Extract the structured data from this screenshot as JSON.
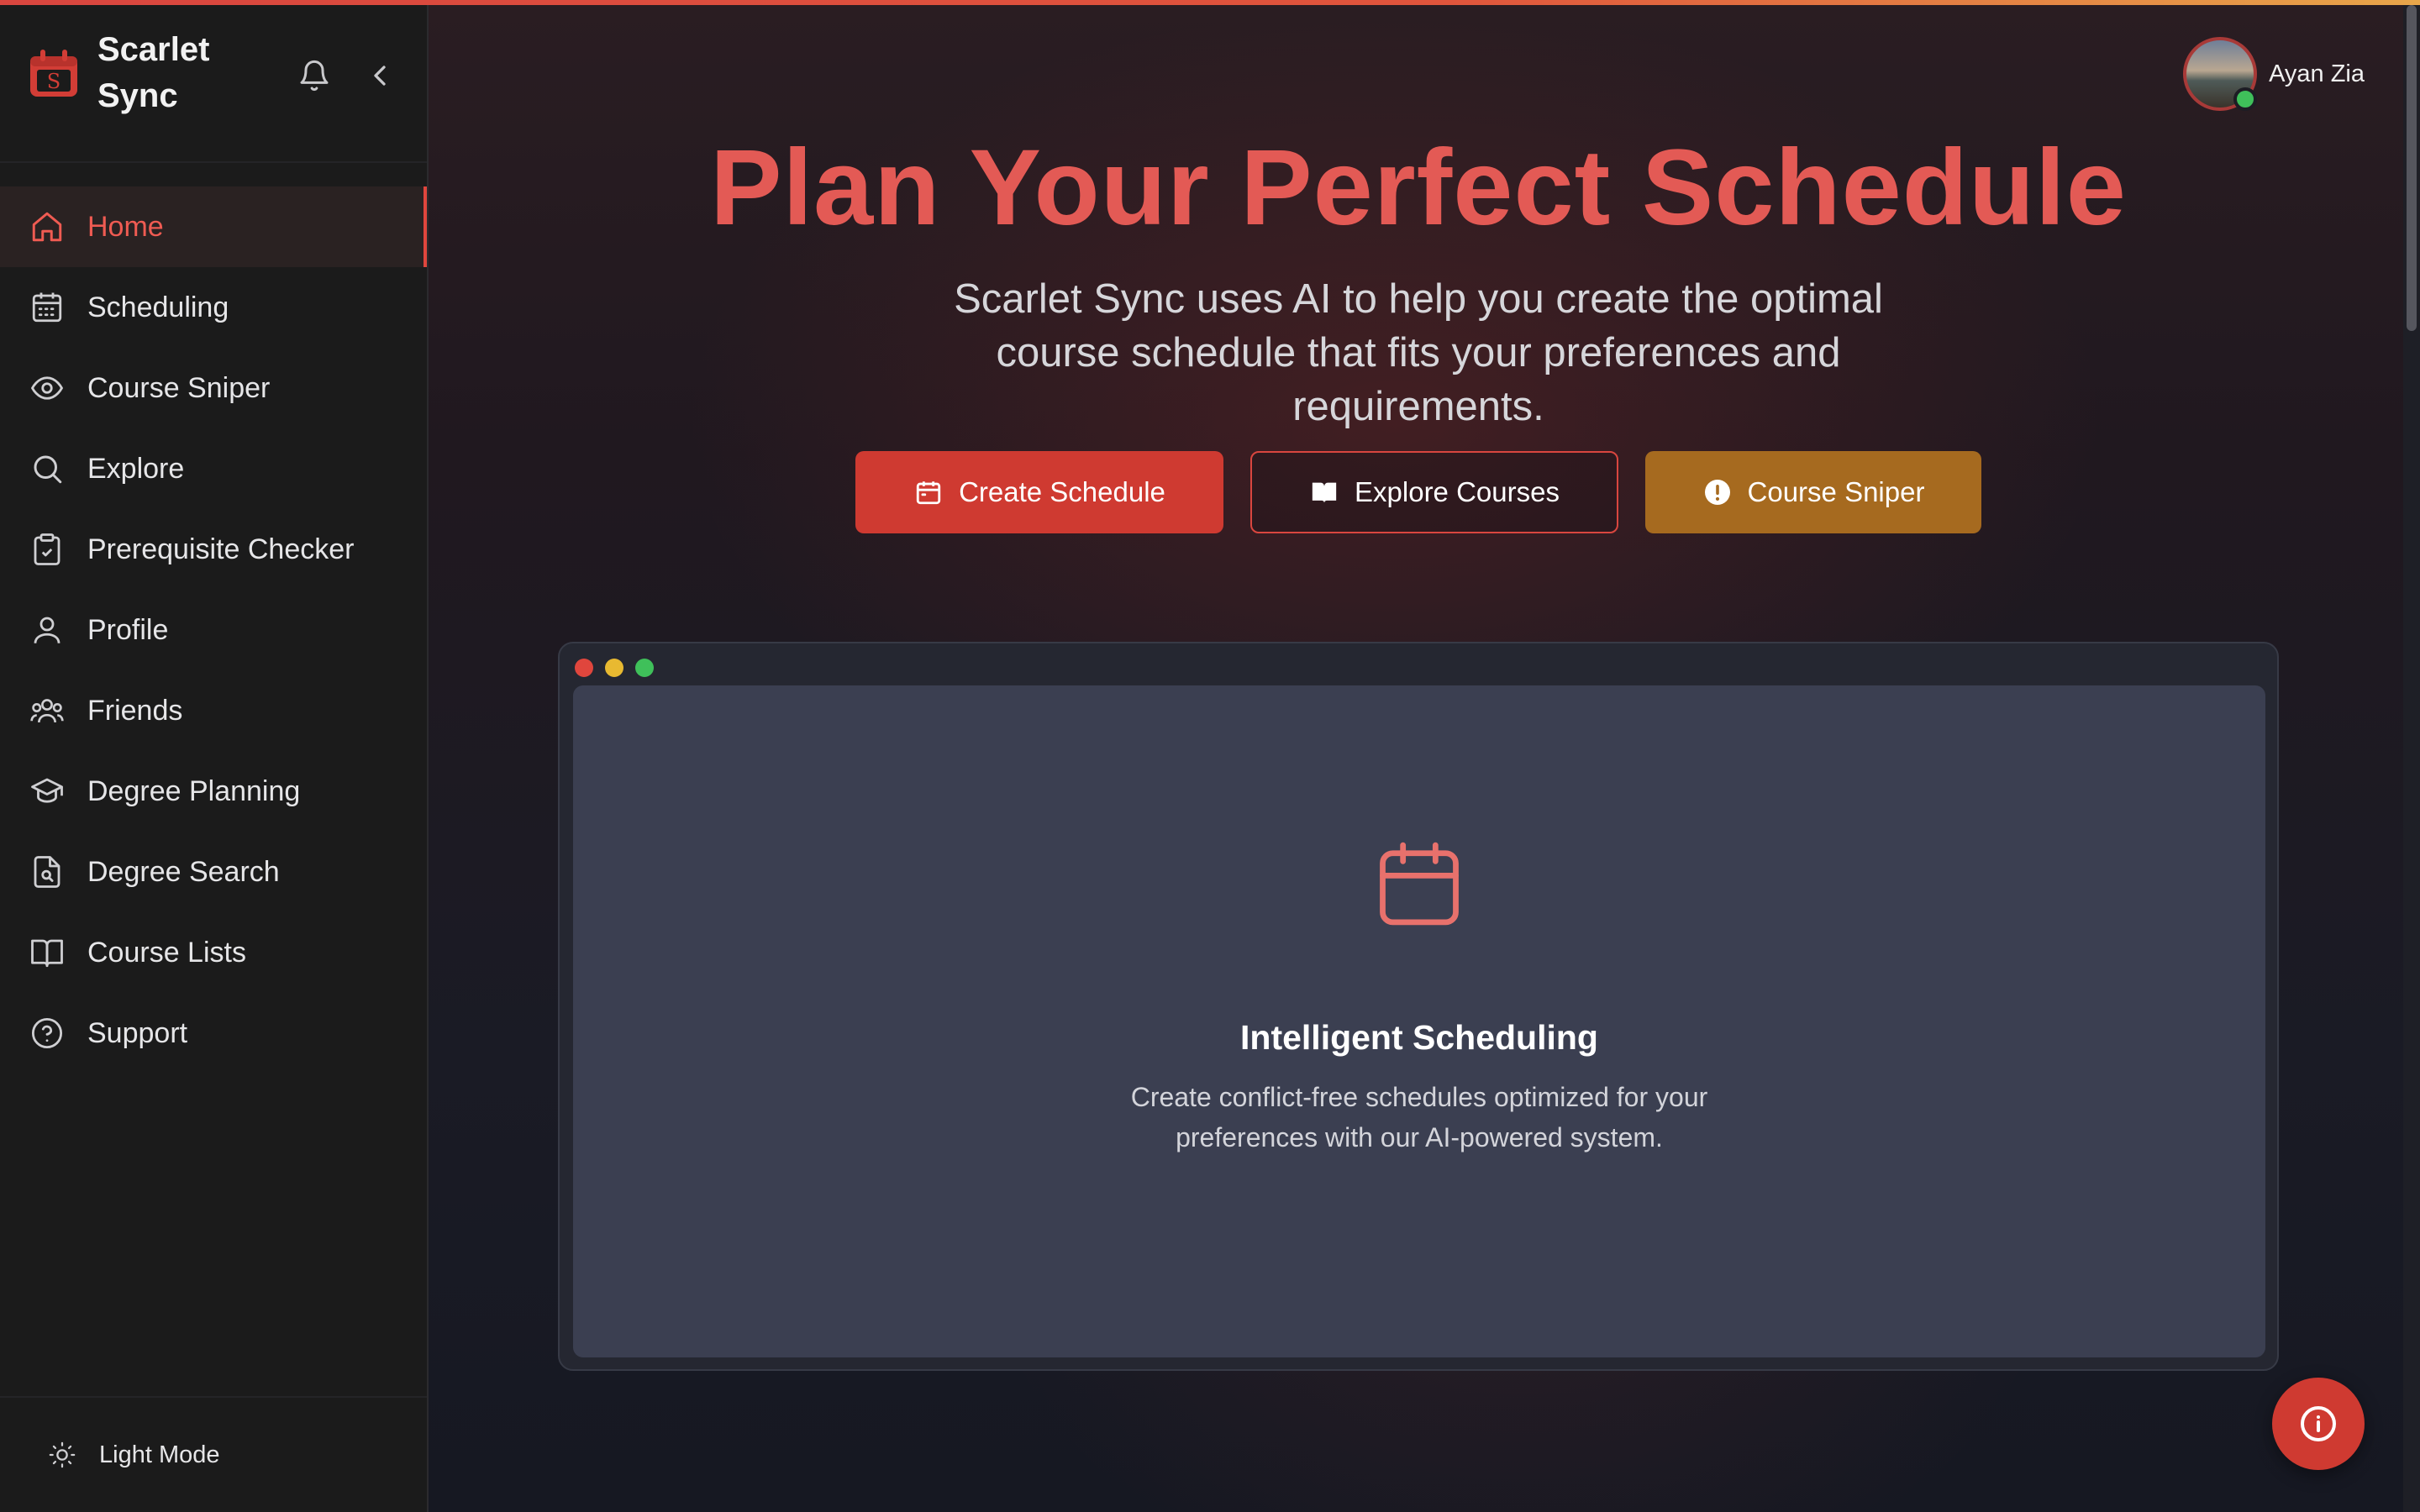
{
  "brand": {
    "name": "Scarlet Sync",
    "logo_icon": "calendar-s-logo"
  },
  "sidebar": {
    "items": [
      {
        "label": "Home",
        "icon": "home-icon",
        "active": true
      },
      {
        "label": "Scheduling",
        "icon": "calendar-grid-icon",
        "active": false
      },
      {
        "label": "Course Sniper",
        "icon": "eye-icon",
        "active": false
      },
      {
        "label": "Explore",
        "icon": "search-icon",
        "active": false
      },
      {
        "label": "Prerequisite Checker",
        "icon": "clipboard-check-icon",
        "active": false
      },
      {
        "label": "Profile",
        "icon": "user-icon",
        "active": false
      },
      {
        "label": "Friends",
        "icon": "users-icon",
        "active": false
      },
      {
        "label": "Degree Planning",
        "icon": "graduation-cap-icon",
        "active": false
      },
      {
        "label": "Degree Search",
        "icon": "file-search-icon",
        "active": false
      },
      {
        "label": "Course Lists",
        "icon": "book-open-icon",
        "active": false
      },
      {
        "label": "Support",
        "icon": "help-circle-icon",
        "active": false
      }
    ],
    "theme_toggle": "Light Mode"
  },
  "user": {
    "name": "Ayan Zia",
    "status": "online"
  },
  "hero": {
    "title": "Plan Your Perfect Schedule",
    "subtitle": "Scarlet Sync uses AI to help you create the optimal course schedule that fits your preferences and requirements."
  },
  "actions": {
    "create": "Create Schedule",
    "explore": "Explore Courses",
    "sniper": "Course Sniper"
  },
  "feature": {
    "title": "Intelligent Scheduling",
    "description": "Create conflict-free schedules optimized for your preferences with our AI-powered system."
  },
  "colors": {
    "accent": "#e35a55",
    "primary_button": "#cf3a31",
    "sniper_button": "#a66a1f",
    "online": "#3fc05a"
  }
}
